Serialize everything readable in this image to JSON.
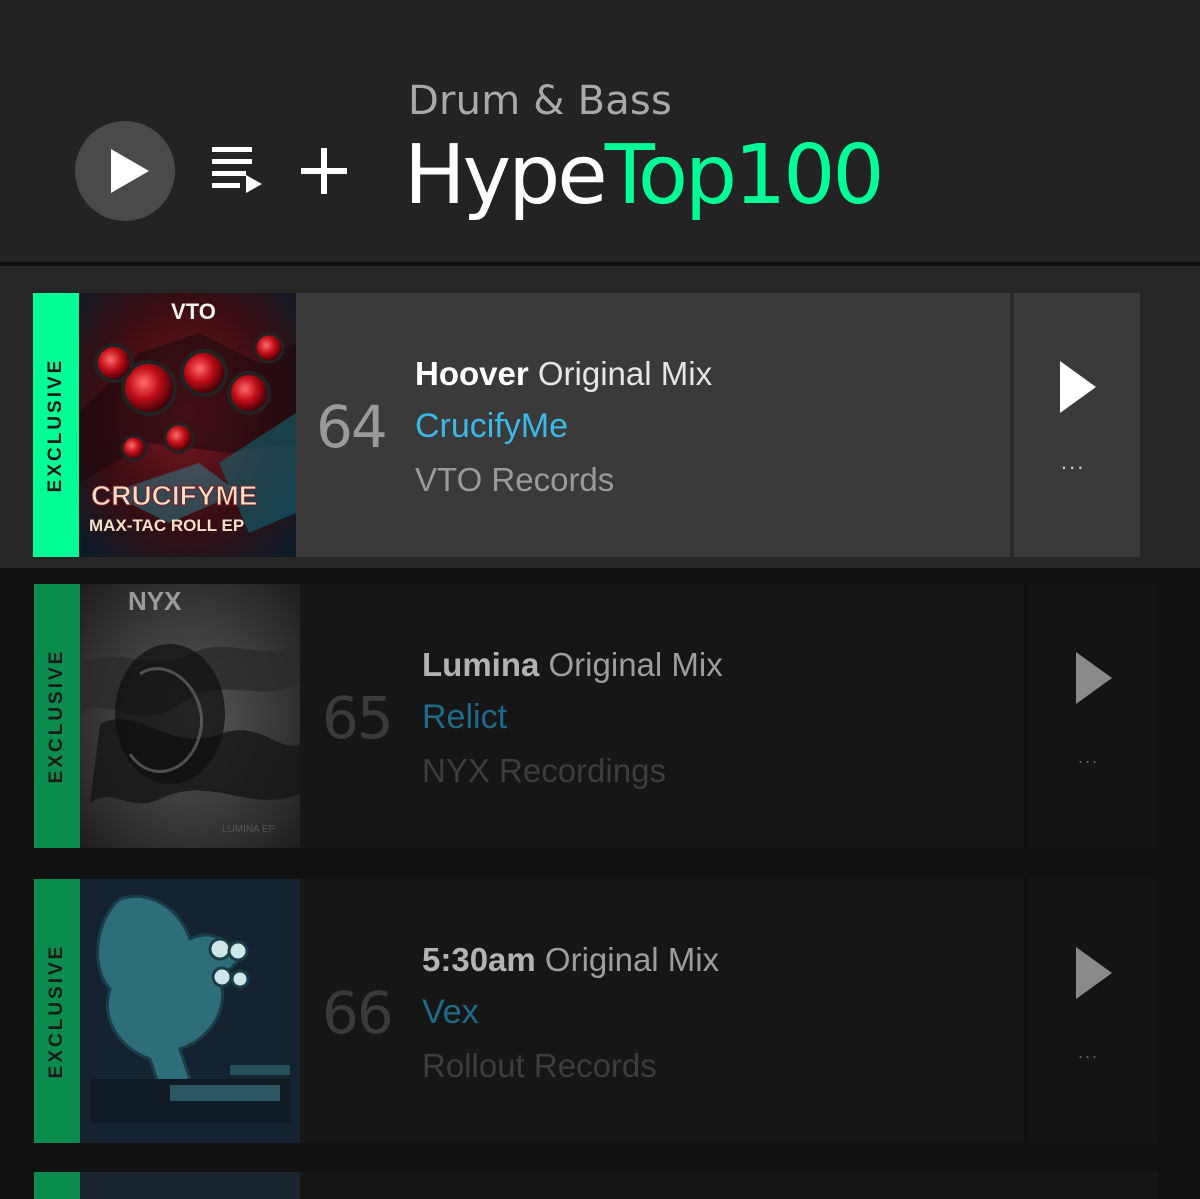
{
  "header": {
    "genre": "Drum & Bass",
    "title_part1": "Hype",
    "title_part2": "Top100",
    "accent_color": "#01ff95",
    "icons": [
      "play-icon",
      "add-to-queue-icon",
      "plus-icon"
    ]
  },
  "tracks": [
    {
      "badge": "EXCLUSIVE",
      "rank": "64",
      "name": "Hoover",
      "mix": "Original Mix",
      "artist": "CrucifyMe",
      "label": "VTO Records",
      "artwork_text": {
        "top": "VTO",
        "main": "CRUCIFYME",
        "sub": "MAX-TAC ROLL EP"
      },
      "more": "..."
    },
    {
      "badge": "EXCLUSIVE",
      "rank": "65",
      "name": "Lumina",
      "mix": "Original Mix",
      "artist": "Relict",
      "label": "NYX Recordings",
      "artwork_text": {
        "top": "NYX",
        "sub": "LUMINA EP"
      },
      "more": "..."
    },
    {
      "badge": "EXCLUSIVE",
      "rank": "66",
      "name": "5:30am",
      "mix": "Original Mix",
      "artist": "Vex",
      "label": "Rollout Records",
      "artwork_text": {},
      "more": "..."
    }
  ]
}
